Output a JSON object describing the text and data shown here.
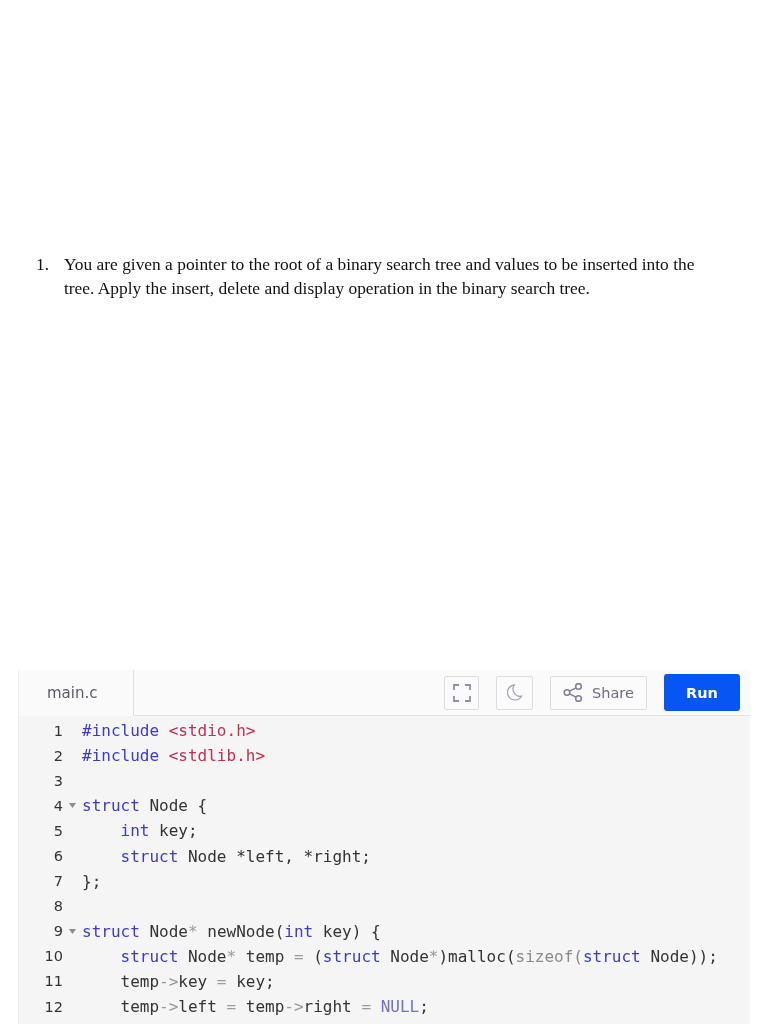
{
  "question": {
    "number": "1.",
    "text": "You are given a pointer to the root of a binary search tree and values to be inserted into the tree. Apply the insert, delete and display operation in the binary search tree."
  },
  "editor": {
    "tabs": [
      {
        "label": "main.c",
        "selected": true
      }
    ],
    "toolbar": [
      {
        "kind": "fullscreen"
      },
      {
        "kind": "theme"
      },
      {
        "kind": "share",
        "label": "Share"
      },
      {
        "kind": "run",
        "label": "Run"
      }
    ],
    "lines": [
      {
        "number": "1",
        "tokens": [
          {
            "kind": "keyword",
            "text": "#include"
          },
          {
            "kind": "string",
            "text": " <stdio.h>"
          }
        ]
      },
      {
        "number": "2",
        "tokens": [
          {
            "kind": "keyword",
            "text": "#include"
          },
          {
            "kind": "string",
            "text": " <stdlib.h>"
          }
        ]
      },
      {
        "number": "3"
      },
      {
        "number": "4",
        "expanded": true,
        "tokens": [
          {
            "kind": "keyword",
            "text": "struct"
          },
          {
            "kind": "plain",
            "text": " Node {"
          }
        ],
        "children": [
          {
            "number": "5",
            "tokens": [
              {
                "kind": "keyword",
                "text": "int"
              },
              {
                "kind": "plain",
                "text": " key;"
              }
            ]
          },
          {
            "number": "6",
            "tokens": [
              {
                "kind": "keyword",
                "text": "struct"
              },
              {
                "kind": "plain",
                "text": " Node *left, *right;"
              }
            ]
          }
        ]
      },
      {
        "number": "7",
        "tokens": [
          {
            "kind": "plain",
            "text": "};"
          }
        ]
      },
      {
        "number": "8"
      },
      {
        "number": "9",
        "expanded": true,
        "tokens": [
          {
            "kind": "keyword",
            "text": "struct"
          },
          {
            "kind": "plain",
            "text": " Node"
          },
          {
            "kind": "operator",
            "text": "*"
          },
          {
            "kind": "plain",
            "text": " newNode("
          },
          {
            "kind": "keyword",
            "text": "int"
          },
          {
            "kind": "plain",
            "text": " key) {"
          }
        ],
        "children": [
          {
            "number": "10",
            "tokens": [
              {
                "kind": "keyword",
                "text": "struct"
              },
              {
                "kind": "plain",
                "text": " Node"
              },
              {
                "kind": "operator",
                "text": "*"
              },
              {
                "kind": "plain",
                "text": " temp "
              },
              {
                "kind": "operator",
                "text": "="
              },
              {
                "kind": "plain",
                "text": " ("
              },
              {
                "kind": "keyword",
                "text": "struct"
              },
              {
                "kind": "plain",
                "text": " Node"
              },
              {
                "kind": "operator",
                "text": "*"
              },
              {
                "kind": "plain",
                "text": ")malloc("
              },
              {
                "kind": "builtin",
                "text": "sizeof("
              },
              {
                "kind": "keyword",
                "text": "struct"
              },
              {
                "kind": "plain",
                "text": " Node));"
              }
            ]
          },
          {
            "number": "11",
            "tokens": [
              {
                "kind": "plain",
                "text": "temp"
              },
              {
                "kind": "operator",
                "text": "->"
              },
              {
                "kind": "plain",
                "text": "key "
              },
              {
                "kind": "operator",
                "text": "="
              },
              {
                "kind": "plain",
                "text": " key;"
              }
            ]
          },
          {
            "number": "12",
            "tokens": [
              {
                "kind": "plain",
                "text": "temp"
              },
              {
                "kind": "operator",
                "text": "->"
              },
              {
                "kind": "plain",
                "text": "left "
              },
              {
                "kind": "operator",
                "text": "="
              },
              {
                "kind": "plain",
                "text": " temp"
              },
              {
                "kind": "operator",
                "text": "->"
              },
              {
                "kind": "plain",
                "text": "right "
              },
              {
                "kind": "operator",
                "text": "= "
              },
              {
                "kind": "constant",
                "text": "NULL"
              },
              {
                "kind": "plain",
                "text": ";"
              }
            ]
          }
        ]
      }
    ]
  }
}
